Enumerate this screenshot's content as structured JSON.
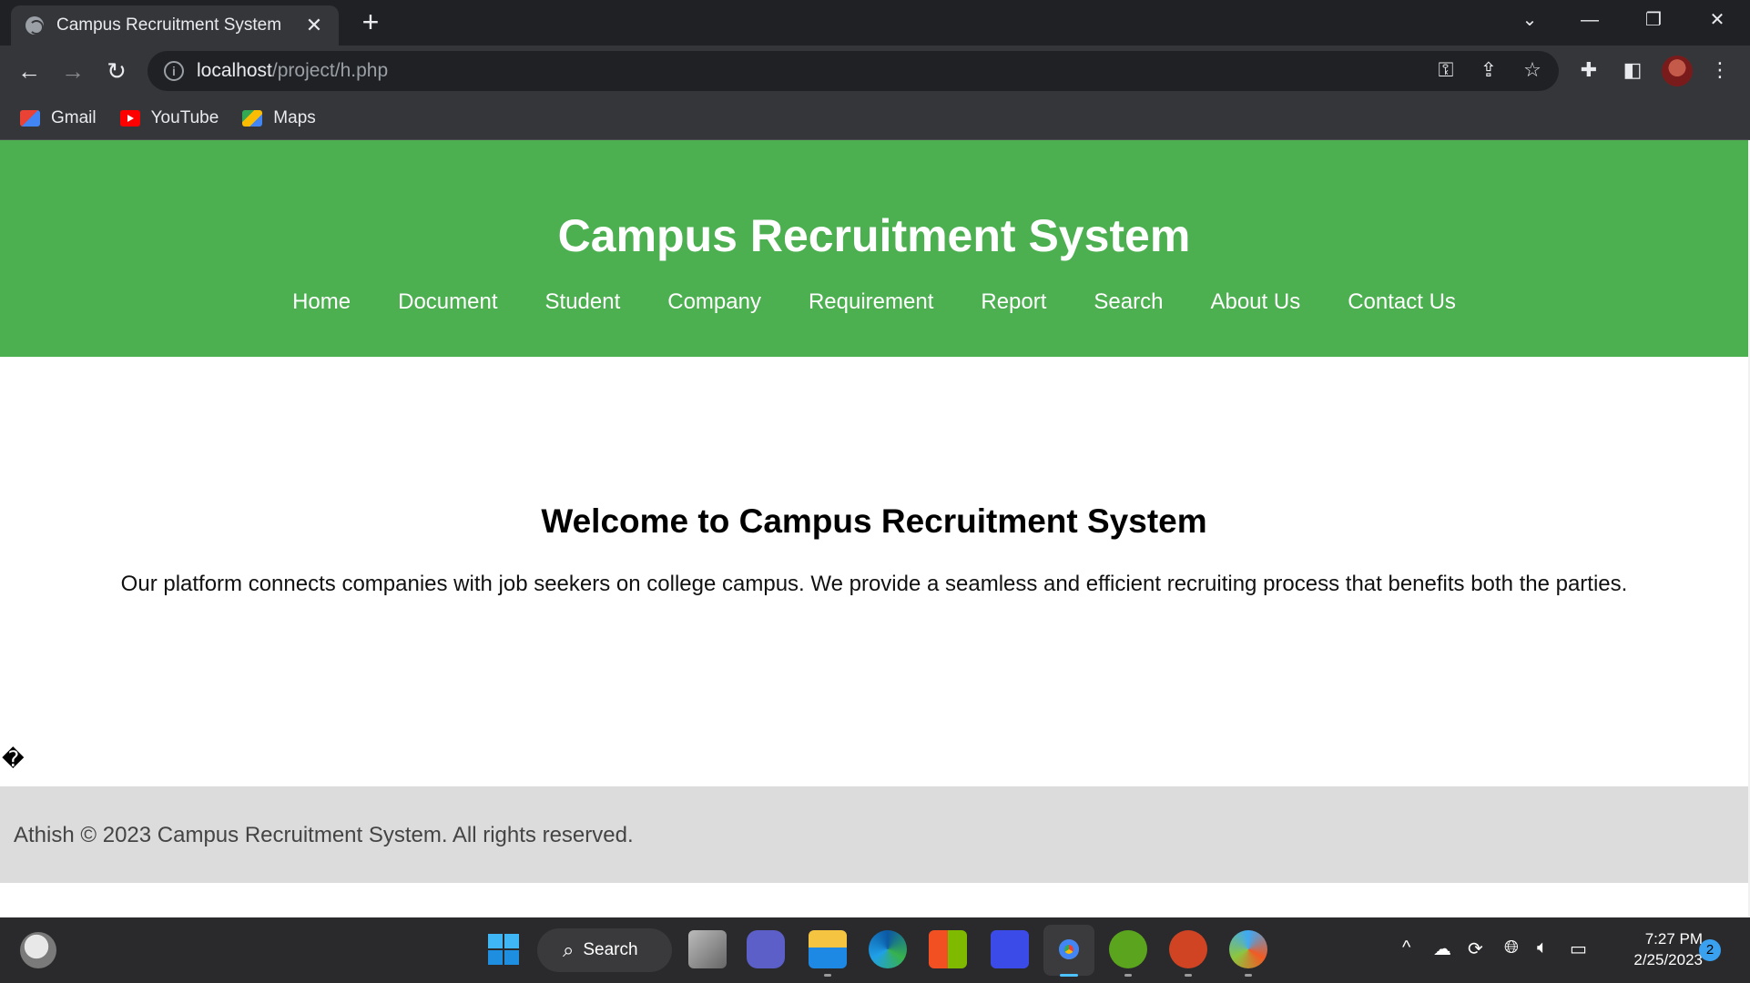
{
  "browser": {
    "tab_title": "Campus Recruitment System",
    "tab_close": "✕",
    "new_tab": "+",
    "url_host": "localhost",
    "url_path": "/project/h.php",
    "bookmarks": [
      {
        "label": "Gmail",
        "icon": "gmail-icon"
      },
      {
        "label": "YouTube",
        "icon": "youtube-icon"
      },
      {
        "label": "Maps",
        "icon": "maps-icon"
      }
    ]
  },
  "site": {
    "title": "Campus Recruitment System",
    "nav": [
      "Home",
      "Document",
      "Student",
      "Company",
      "Requirement",
      "Report",
      "Search",
      "About Us",
      "Contact Us"
    ],
    "welcome_heading": "Welcome to Campus Recruitment System",
    "intro": "Our platform connects companies with job seekers on college campus. We provide a seamless and efficient recruiting process that benefits both the parties.",
    "footer": "Athish © 2023 Campus Recruitment System. All rights reserved.",
    "stray_glyph": "�",
    "header_color": "#4caf50",
    "footer_color": "#dcdcdc"
  },
  "taskbar": {
    "search_label": "Search",
    "time": "7:27 PM",
    "date": "2/25/2023",
    "notification_count": "2"
  }
}
